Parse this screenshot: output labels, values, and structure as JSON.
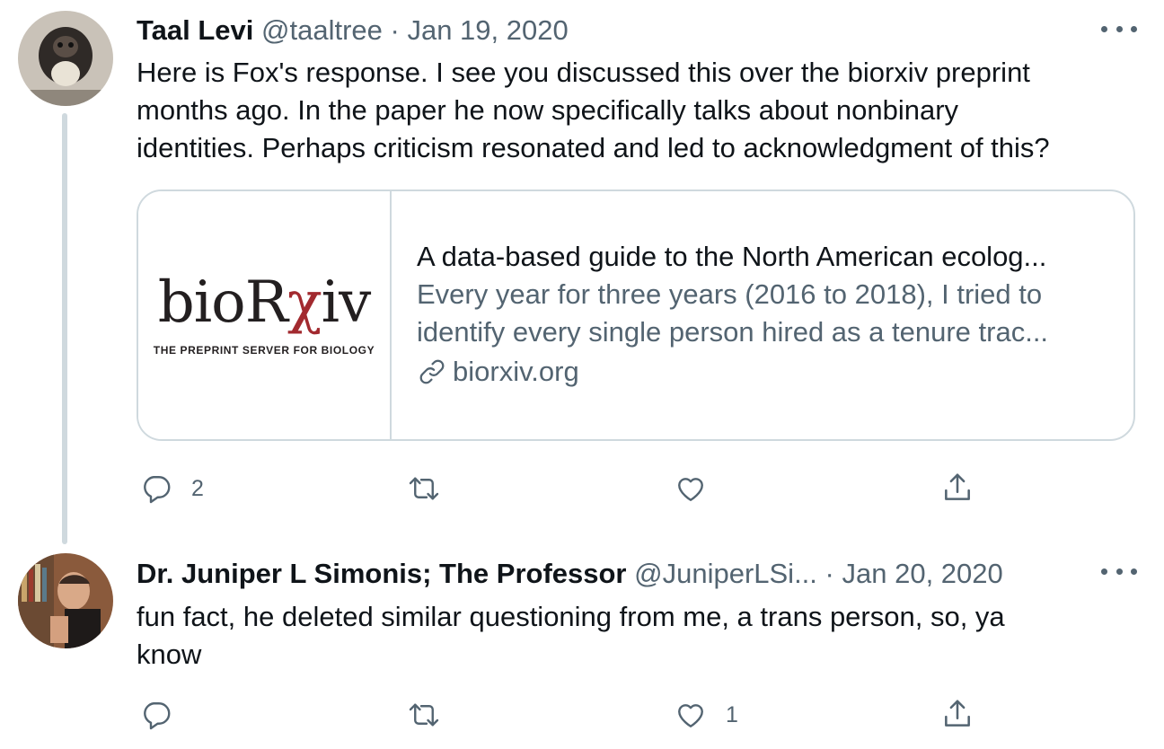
{
  "tweets": [
    {
      "name": "Taal Levi",
      "handle": "@taaltree",
      "separator": "·",
      "date": "Jan 19, 2020",
      "lines": [
        "Here is Fox's response. I see you discussed this over the biorxiv preprint",
        "months ago. In the paper he now specifically talks about nonbinary",
        "identities. Perhaps criticism resonated and led to acknowledgment of this?"
      ],
      "card": {
        "logo_main": "bioR",
        "logo_chi": "χ",
        "logo_end": "iv",
        "logo_sub": "THE PREPRINT SERVER FOR BIOLOGY",
        "title": "A data-based guide to the North American ecolog...",
        "desc_lines": [
          "Every year for three years (2016 to 2018), I tried to",
          "identify every single person hired as a tenure trac..."
        ],
        "domain": "biorxiv.org"
      },
      "actions": {
        "replies": "2",
        "retweets": "",
        "likes": ""
      }
    },
    {
      "name": "Dr. Juniper L Simonis; The Professor",
      "handle": "@JuniperLSi...",
      "separator": "·",
      "date": "Jan 20, 2020",
      "lines": [
        "fun fact, he deleted similar questioning from me, a trans person, so, ya",
        "know"
      ],
      "actions": {
        "replies": "",
        "retweets": "",
        "likes": "1"
      }
    }
  ],
  "icons": {
    "reply": "reply-icon",
    "retweet": "retweet-icon",
    "like": "heart-icon",
    "share": "share-icon",
    "more": "more-icon",
    "link": "link-icon"
  },
  "colors": {
    "text": "#0f1419",
    "secondary": "#536471",
    "border": "#cfd9de",
    "biorxiv_red": "#a22a2f"
  }
}
